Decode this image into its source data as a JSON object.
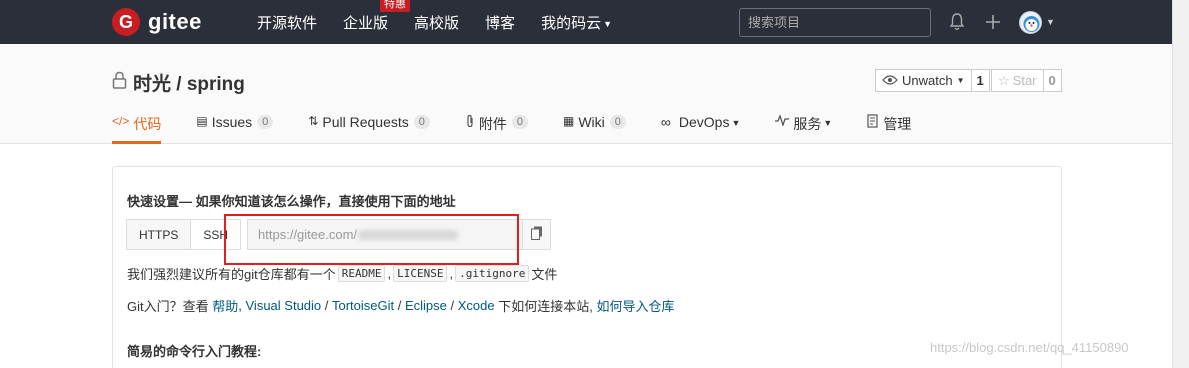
{
  "nav": {
    "logo_mark": "G",
    "logo_text": "gitee",
    "links": [
      {
        "label": "开源软件"
      },
      {
        "label": "企业版",
        "badge": "特惠"
      },
      {
        "label": "高校版"
      },
      {
        "label": "博客"
      },
      {
        "label": "我的码云",
        "dropdown": true
      }
    ],
    "search_placeholder": "搜索项目",
    "icons": [
      "bell-icon",
      "plus-icon"
    ]
  },
  "repo": {
    "title": "时光 / spring",
    "watch_label": "Unwatch",
    "watch_count": "1",
    "star_label": "Star",
    "star_count": "0"
  },
  "tabs": [
    {
      "label": "代码",
      "icon": "code-icon",
      "active": true
    },
    {
      "label": "Issues",
      "icon": "issues-icon",
      "count": "0"
    },
    {
      "label": "Pull Requests",
      "icon": "pull-request-icon",
      "count": "0"
    },
    {
      "label": "附件",
      "icon": "attachment-icon",
      "count": "0"
    },
    {
      "label": "Wiki",
      "icon": "wiki-icon",
      "count": "0"
    },
    {
      "label": "DevOps",
      "icon": "devops-icon",
      "dropdown": true
    },
    {
      "label": "服务",
      "icon": "service-icon",
      "dropdown": true
    },
    {
      "label": "管理",
      "icon": "manage-icon"
    }
  ],
  "quick_setup": {
    "title": "快速设置— 如果你知道该怎么操作，直接使用下面的地址",
    "https_label": "HTTPS",
    "ssh_label": "SSH",
    "url_value": "https://gitee.com/",
    "recommend_prefix": "我们强烈建议所有的git仓库都有一个",
    "readme": "README",
    "license": "LICENSE",
    "gitignore": ".gitignore",
    "recommend_suffix": "文件",
    "git_intro_prefix": "Git入门？查看",
    "help_link": "帮助",
    "tools_links": [
      "Visual Studio",
      "TortoiseGit",
      "Eclipse",
      "Xcode"
    ],
    "tools_suffix": "下如何连接本站,",
    "import_link": "如何导入仓库",
    "command_title": "简易的命令行入门教程:"
  },
  "watermark": "https://blog.csdn.net/qq_41150890",
  "colors": {
    "nav_bg": "#2b2f3a",
    "brand_red": "#c71d23",
    "active_tab": "#e6671d",
    "link": "#005980",
    "highlight_box": "#e02020"
  }
}
